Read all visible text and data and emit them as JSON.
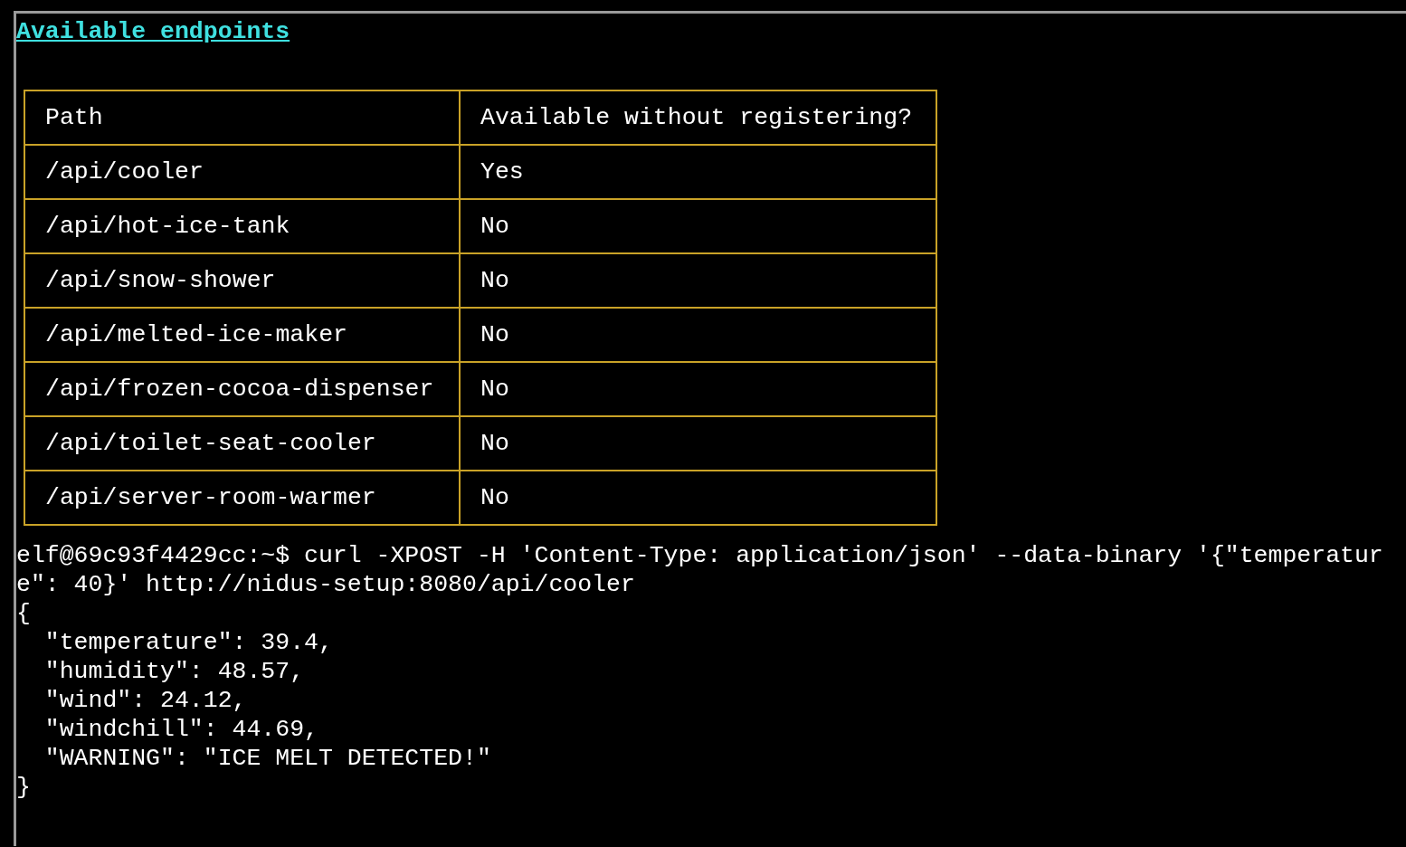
{
  "heading": "Available endpoints",
  "table": {
    "columns": [
      "Path",
      "Available without registering?"
    ],
    "rows": [
      [
        "/api/cooler",
        "Yes"
      ],
      [
        "/api/hot-ice-tank",
        "No"
      ],
      [
        "/api/snow-shower",
        "No"
      ],
      [
        "/api/melted-ice-maker",
        "No"
      ],
      [
        "/api/frozen-cocoa-dispenser",
        "No"
      ],
      [
        "/api/toilet-seat-cooler",
        "No"
      ],
      [
        "/api/server-room-warmer",
        "No"
      ]
    ]
  },
  "terminal": {
    "lines": [
      "elf@69c93f4429cc:~$ curl -XPOST -H 'Content-Type: application/json' --data-binary '{\"temperatur",
      "e\": 40}' http://nidus-setup:8080/api/cooler",
      "{",
      "  \"temperature\": 39.4,",
      "  \"humidity\": 48.57,",
      "  \"wind\": 24.12,",
      "  \"windchill\": 44.69,",
      "  \"WARNING\": \"ICE MELT DETECTED!\"",
      "}"
    ]
  }
}
